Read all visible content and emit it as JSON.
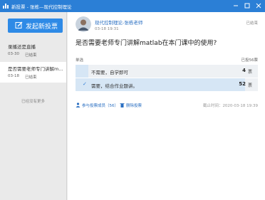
{
  "window": {
    "title": "新投票 - 张栋—现代控制理论",
    "colors": {
      "titlebar": "#2b7fd6",
      "accent": "#2e8ae6",
      "link": "#2a6fc2"
    }
  },
  "sidebar": {
    "new_vote_label": "发起新投票",
    "items": [
      {
        "title": "录播还是直播",
        "date": "03-30",
        "status": "已结束",
        "active": false
      },
      {
        "title": "是否需要老师专门讲解m...",
        "date": "03-18",
        "status": "已结束",
        "active": true
      }
    ],
    "no_more": "已经没有更多"
  },
  "vote": {
    "poster": "现代控制理论-张栋老师",
    "time": "03-18 19:31",
    "status": "已结束",
    "question": "是否需要老师专门讲解matlab在本门课中的使用?",
    "type": "单选",
    "total": "已投56票",
    "options": [
      {
        "label": "不需要，自学即可",
        "count": "4",
        "unit": "票",
        "fraction": 0.07,
        "selected": false
      },
      {
        "label": "需要，结合作业题讲。",
        "count": "52",
        "unit": "票",
        "fraction": 0.93,
        "selected": true
      }
    ],
    "participants": "参与投票成员（56）",
    "delete": "删除投票",
    "deadline": "截止时间：2020-03-18 19:39"
  }
}
